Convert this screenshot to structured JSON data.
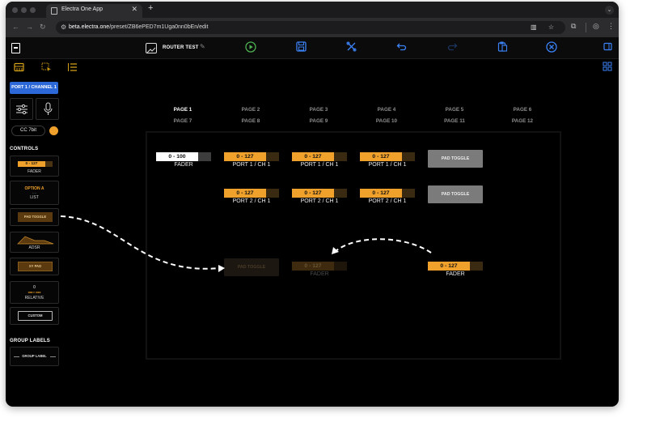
{
  "browser": {
    "tab_title": "Electra One App",
    "tab_close": "✕",
    "new_tab": "+",
    "tabs_menu": "⌄",
    "url_host": "beta.electra.one",
    "url_path": "/preset/ZB6ePED7m1Uga0nn0bEn/edit",
    "nav_back": "←",
    "nav_forward": "→",
    "nav_reload": "↻"
  },
  "header": {
    "preset_name": "ROUTER TEST",
    "pencil": "✎"
  },
  "sidebar": {
    "port_selector": "PORT 1 / CHANNEL 1",
    "cc_mode": "CC 7bit",
    "controls_title": "CONTROLS",
    "tiles": [
      {
        "value": "0 - 127",
        "label": "FADER"
      },
      {
        "value": "OPTION A",
        "sub": "....",
        "label": "LIST"
      },
      {
        "value": "PAD TOGGLE"
      },
      {
        "label": "ADSR"
      },
      {
        "value": "XY PAD"
      },
      {
        "value": "0",
        "sub": "◂◂◂ ▪▪ ▸▸▸",
        "label": "RELATIVE"
      },
      {
        "value": "CUSTOM"
      }
    ],
    "group_labels_title": "GROUP LABELS",
    "group_label_tile": "GROUP LABEL"
  },
  "pages": {
    "row1": [
      "PAGE 1",
      "PAGE 2",
      "PAGE 3",
      "PAGE 4",
      "PAGE 5",
      "PAGE 6"
    ],
    "row2": [
      "PAGE 7",
      "PAGE 8",
      "PAGE 9",
      "PAGE 10",
      "PAGE 11",
      "PAGE 12"
    ]
  },
  "controls": [
    {
      "value": "0 - 100",
      "label": "FADER"
    },
    {
      "value": "0 - 127",
      "label": "PORT 1 / CH 1"
    },
    {
      "value": "0 - 127",
      "label": "PORT 1 / CH 1"
    },
    {
      "value": "0 - 127",
      "label": "PORT 1 / CH 1"
    },
    {
      "value": "PAD TOGGLE"
    },
    {
      "value": "0 - 127",
      "label": "PORT 2 / CH 1"
    },
    {
      "value": "0 - 127",
      "label": "PORT 2 / CH 1"
    },
    {
      "value": "0 - 127",
      "label": "PORT 2 / CH 1"
    },
    {
      "value": "PAD TOGGLE"
    },
    {
      "value": "PAD TOGGLE"
    },
    {
      "value": "0 - 127",
      "label": "FADER"
    },
    {
      "value": "0 - 127",
      "label": "FADER"
    }
  ],
  "colors": {
    "accent_orange": "#f0a12c",
    "accent_blue": "#3b82f6",
    "run_green": "#4caf50",
    "selector_blue": "#2d68d8"
  },
  "icons": {
    "play": "▷",
    "save": "▣",
    "tools": "✂",
    "undo": "↩",
    "redo": "↪",
    "paste": "❐",
    "close": "✕",
    "sliders": "≡",
    "microphone": "🎙"
  }
}
